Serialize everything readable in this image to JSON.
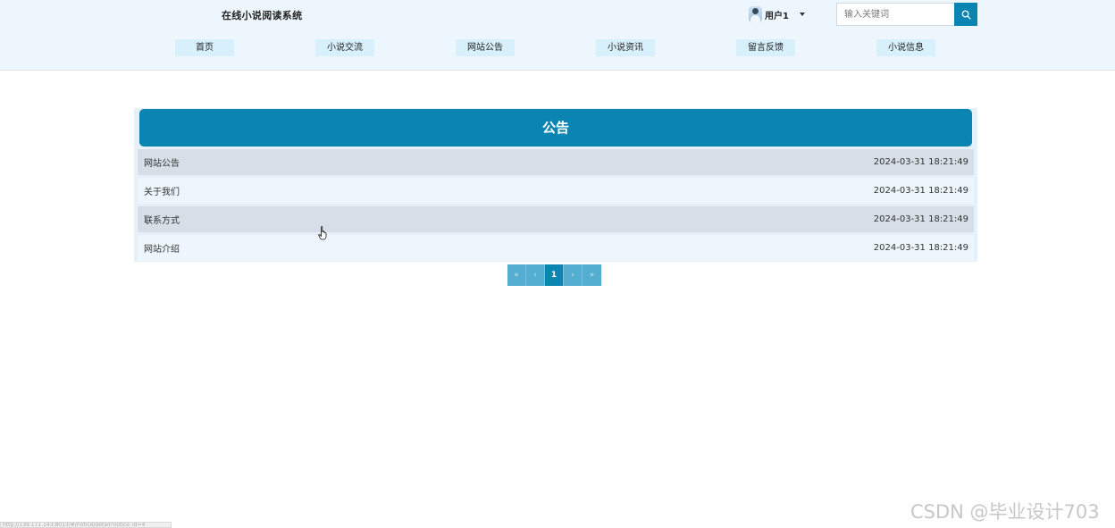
{
  "header": {
    "site_title": "在线小说阅读系统",
    "user_name": "用户1",
    "search_placeholder": "输入关键词"
  },
  "nav": {
    "items": [
      {
        "label": "首页"
      },
      {
        "label": "小说交流"
      },
      {
        "label": "网站公告"
      },
      {
        "label": "小说资讯"
      },
      {
        "label": "留言反馈"
      },
      {
        "label": "小说信息"
      }
    ]
  },
  "notice": {
    "title": "公告",
    "rows": [
      {
        "name": "网站公告",
        "time": "2024-03-31 18:21:49"
      },
      {
        "name": "关于我们",
        "time": "2024-03-31 18:21:49"
      },
      {
        "name": "联系方式",
        "time": "2024-03-31 18:21:49"
      },
      {
        "name": "网站介绍",
        "time": "2024-03-31 18:21:49"
      }
    ]
  },
  "pagination": {
    "first": "«",
    "prev": "‹",
    "current": "1",
    "next": "›",
    "last": "»"
  },
  "status_bar": {
    "url": "http://139.171.143:8013/#/notice/detail?notice_id=4"
  },
  "watermark": "CSDN @毕业设计703",
  "colors": {
    "accent": "#0a85b2",
    "header_bg": "#eef6fd",
    "nav_item_bg": "#d7f0fb",
    "row_dark": "#d6dfe7",
    "row_light": "#eef6fd"
  }
}
